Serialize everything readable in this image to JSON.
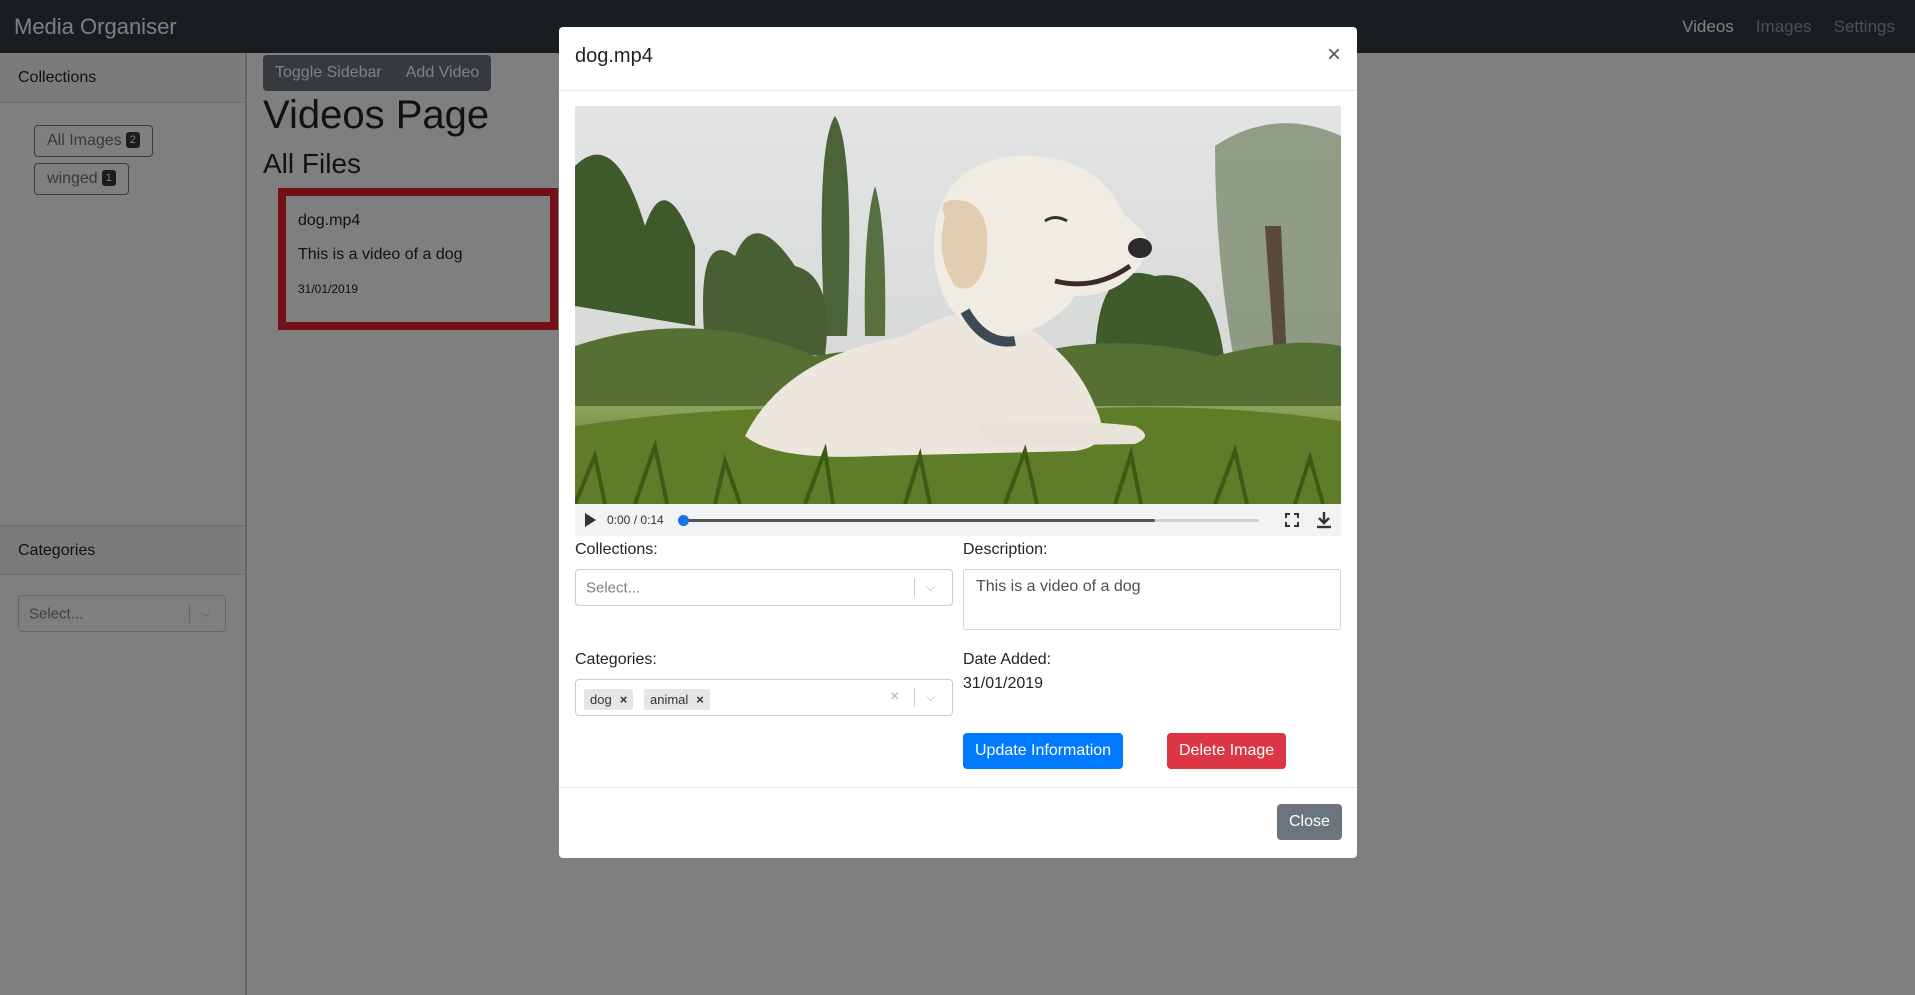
{
  "navbar": {
    "brand": "Media Organiser",
    "links": [
      "Videos",
      "Images",
      "Settings"
    ]
  },
  "sidebar": {
    "collections_title": "Collections",
    "collections": [
      {
        "label": "All Images",
        "count": "2"
      },
      {
        "label": "winged",
        "count": "1"
      }
    ],
    "categories_title": "Categories",
    "categories_placeholder": "Select..."
  },
  "main": {
    "toggle_sidebar": "Toggle Sidebar",
    "add_video": "Add Video",
    "page_title": "Videos Page",
    "section_title": "All Files",
    "files": [
      {
        "name": "dog.mp4",
        "description": "This is a video of a dog",
        "date": "31/01/2019"
      }
    ]
  },
  "modal": {
    "title": "dog.mp4",
    "close_symbol": "×",
    "video": {
      "time": "0:00 / 0:14",
      "buffered_fraction": 0.82,
      "played_fraction": 0.0
    },
    "collections_label": "Collections:",
    "collections_placeholder": "Select...",
    "description_label": "Description:",
    "description_value": "This is a video of a dog",
    "categories_label": "Categories:",
    "categories_tags": [
      "dog",
      "animal"
    ],
    "date_label": "Date Added:",
    "date_value": "31/01/2019",
    "update_button": "Update Information",
    "delete_button": "Delete Image",
    "close_button": "Close"
  },
  "colors": {
    "navbar": "#343a40",
    "primary": "#007bff",
    "danger": "#dc3545",
    "secondary": "#6c757d",
    "highlight": "#e6202a"
  }
}
